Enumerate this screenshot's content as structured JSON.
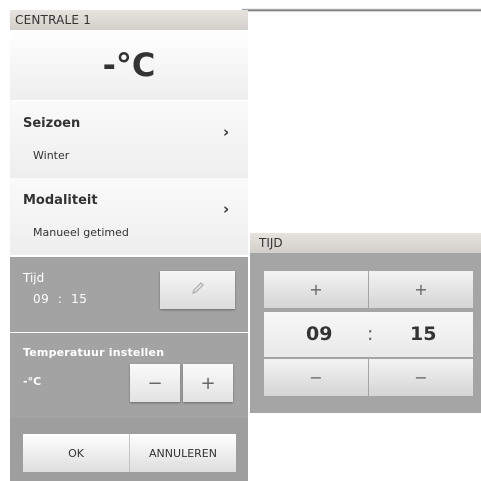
{
  "main_panel": {
    "title": "CENTRALE 1",
    "current_temperature": "-°C",
    "seizoen": {
      "label": "Seizoen",
      "value": "Winter",
      "chevron": "›"
    },
    "modaliteit": {
      "label": "Modaliteit",
      "value": "Manueel getimed",
      "chevron": "›"
    },
    "tijd": {
      "label": "Tijd",
      "hours": "09",
      "separator": ":",
      "minutes": "15",
      "edit_icon": "pencil-icon"
    },
    "temperature_setting": {
      "label": "Temperatuur instellen",
      "value": "-°C",
      "minus_label": "−",
      "plus_label": "+"
    },
    "footer": {
      "ok_label": "OK",
      "cancel_label": "ANNULEREN"
    }
  },
  "time_dialog": {
    "title": "TIJD",
    "hour_plus": "+",
    "minute_plus": "+",
    "hours": "09",
    "separator": ":",
    "minutes": "15",
    "hour_minus": "−",
    "minute_minus": "−"
  },
  "colors": {
    "header_bg": "#dcd9d4",
    "section_gray": "#a3a3a3",
    "text_dark": "#333333",
    "text_white": "#ffffff"
  }
}
